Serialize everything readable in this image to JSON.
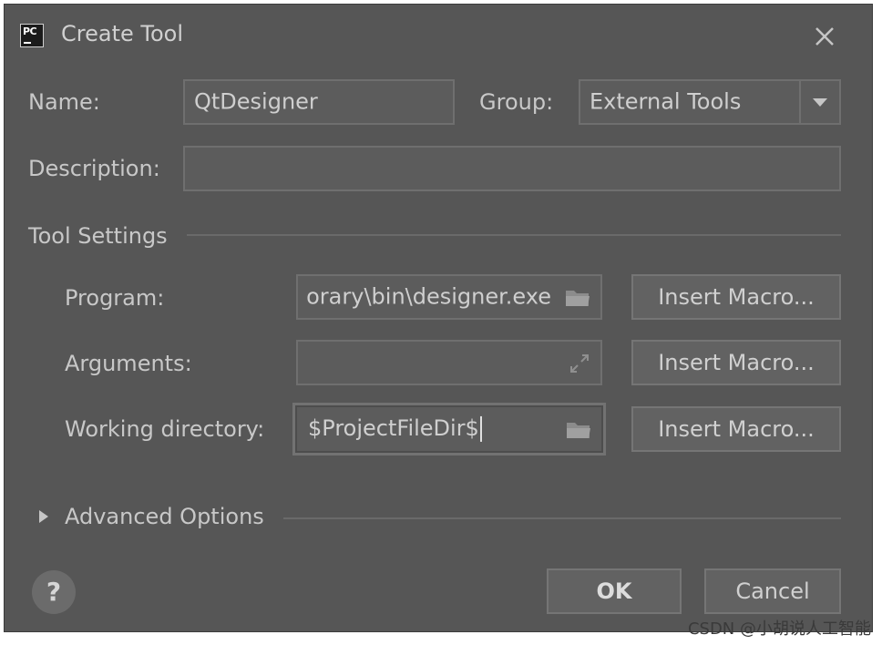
{
  "dialog": {
    "title": "Create Tool"
  },
  "form": {
    "name_label": "Name:",
    "name_value": "QtDesigner",
    "group_label": "Group:",
    "group_value": "External Tools",
    "description_label": "Description:",
    "description_value": ""
  },
  "tool_settings": {
    "section_label": "Tool Settings",
    "program_label": "Program:",
    "program_value": "orary\\bin\\designer.exe",
    "arguments_label": "Arguments:",
    "arguments_value": "",
    "working_dir_label": "Working directory:",
    "working_dir_value": "$ProjectFileDir$",
    "insert_macro_label": "Insert Macro..."
  },
  "advanced": {
    "label": "Advanced Options"
  },
  "footer": {
    "help_label": "?",
    "ok_label": "OK",
    "cancel_label": "Cancel"
  },
  "watermark": "CSDN @小胡说人工智能",
  "icons": {
    "app": "pycharm-icon",
    "close": "close-icon",
    "dropdown": "chevron-down-icon",
    "folder": "folder-icon",
    "expand": "expand-icon",
    "disclosure": "triangle-right-icon",
    "help": "help-icon"
  },
  "colors": {
    "dialog_bg": "#565656",
    "field_bg": "#5c5c5c",
    "text": "#c8c8c8"
  }
}
